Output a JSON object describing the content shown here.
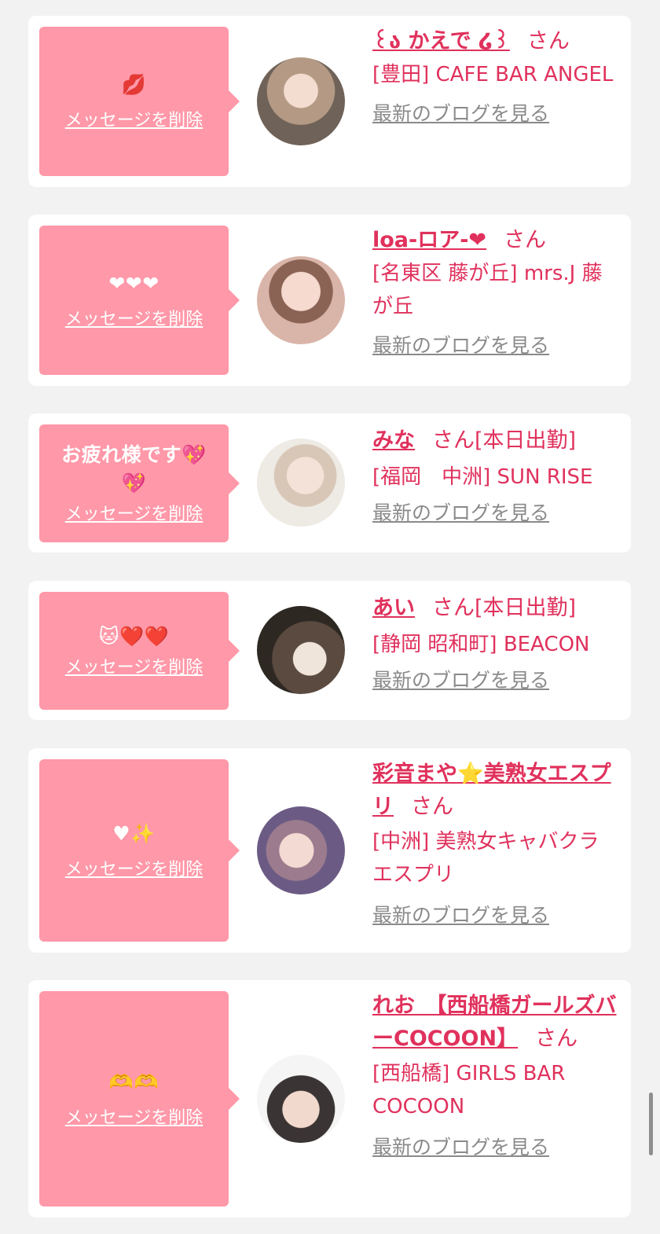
{
  "delete_label": "メッセージを削除",
  "blog_label": "最新のブログを見る",
  "san_label": "さん",
  "colors": {
    "background": "#f2f2f2",
    "bubble": "#ff98a8",
    "accent": "#e0315c",
    "link_gray": "#8a8a8a"
  },
  "entries": [
    {
      "message": "💋",
      "name": "꒰ა かえで ໒꒱",
      "shift": "",
      "shop": "[豊田] CAFE BAR ANGEL",
      "avatar": "photo"
    },
    {
      "message": "❤︎❤︎❤︎",
      "name": "loa-ロア-❤",
      "shift": "",
      "shop": "[名東区 藤が丘] mrs.J 藤が丘",
      "avatar": "photo"
    },
    {
      "message": "お疲れ様です💖💖",
      "name": "みな",
      "shift": "[本日出勤]",
      "shop": "[福岡　中洲] SUN RISE",
      "avatar": "photo"
    },
    {
      "message": "🐱❤️❤️",
      "name": "あい",
      "shift": "[本日出勤]",
      "shop": "[静岡 昭和町] BEACON",
      "avatar": "photo"
    },
    {
      "message": "♥✨",
      "name": "彩音まや⭐美熟女エスプリ",
      "shift": "",
      "shop": "[中洲] 美熟女キャバクラ エスプリ",
      "avatar": "photo"
    },
    {
      "message": "🫶🫶",
      "name": "れお　【西船橋ガールズバーCOCOON】",
      "shift": "",
      "shop": "[西船橋] GIRLS BAR COCOON",
      "avatar": "photo"
    }
  ]
}
